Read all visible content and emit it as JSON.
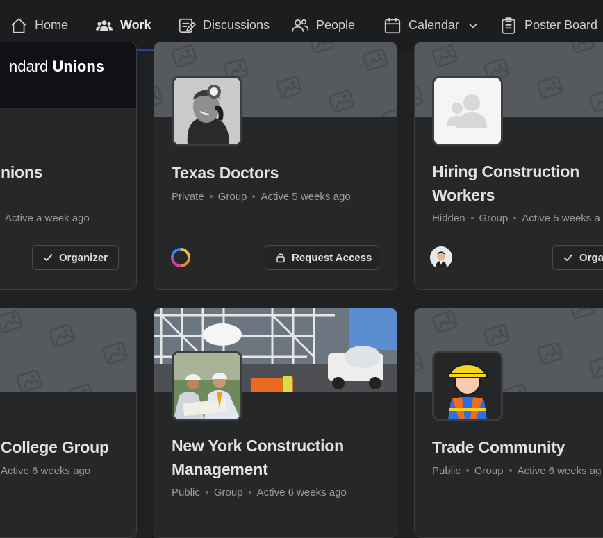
{
  "nav": {
    "items": [
      {
        "label": "Home",
        "icon": "home-icon"
      },
      {
        "label": "Work",
        "icon": "people-group-icon",
        "active": true
      },
      {
        "label": "Discussions",
        "icon": "discussions-icon"
      },
      {
        "label": "People",
        "icon": "people-icon"
      },
      {
        "label": "Calendar",
        "icon": "calendar-icon",
        "has_dropdown": true
      },
      {
        "label": "Poster Board",
        "icon": "clipboard-icon"
      }
    ]
  },
  "cards": {
    "unions": {
      "banner_text_a": "ndard",
      "banner_text_b": "Unions",
      "title": "nions",
      "meta_activity": "Active a week ago",
      "button": "Organizer"
    },
    "texas": {
      "title": "Texas Doctors",
      "meta_privacy": "Private",
      "meta_type": "Group",
      "meta_activity": "Active 5 weeks ago",
      "button": "Request Access"
    },
    "hiring": {
      "title_line1": "Hiring Construction",
      "title_line2": "Workers",
      "meta_privacy": "Hidden",
      "meta_type": "Group",
      "meta_activity": "Active 5 weeks a",
      "button": "Orga"
    },
    "college": {
      "title": "College Group",
      "meta_activity": "Active 6 weeks ago"
    },
    "nycm": {
      "title_line1": "New York Construction",
      "title_line2": "Management",
      "meta_privacy": "Public",
      "meta_type": "Group",
      "meta_activity": "Active 6 weeks ago"
    },
    "trade": {
      "title": "Trade Community",
      "meta_privacy": "Public",
      "meta_type": "Group",
      "meta_activity": "Active 6 weeks ag"
    }
  },
  "colors": {
    "background": "#202122",
    "card": "#262728",
    "banner_placeholder": "#56595e",
    "nav_active_underline": "#2a3fb0"
  }
}
